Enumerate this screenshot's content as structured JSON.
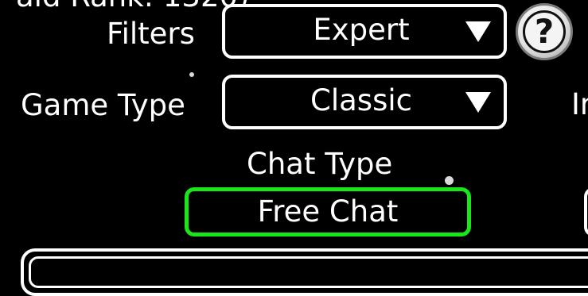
{
  "top_partial_text": "ald Rank: 1320)",
  "filters": {
    "label": "Filters",
    "selected": "Expert"
  },
  "game_type": {
    "label": "Game Type",
    "selected": "Classic"
  },
  "help": {
    "glyph": "?"
  },
  "chat_type": {
    "label": "Chat Type",
    "selected_button": "Free Chat"
  },
  "right_partial_label": "In",
  "colors": {
    "background": "#000000",
    "text": "#ffffff",
    "selected_border": "#19e619"
  },
  "icons": {
    "dropdown": "chevron-down-icon",
    "help": "question-mark-icon"
  }
}
